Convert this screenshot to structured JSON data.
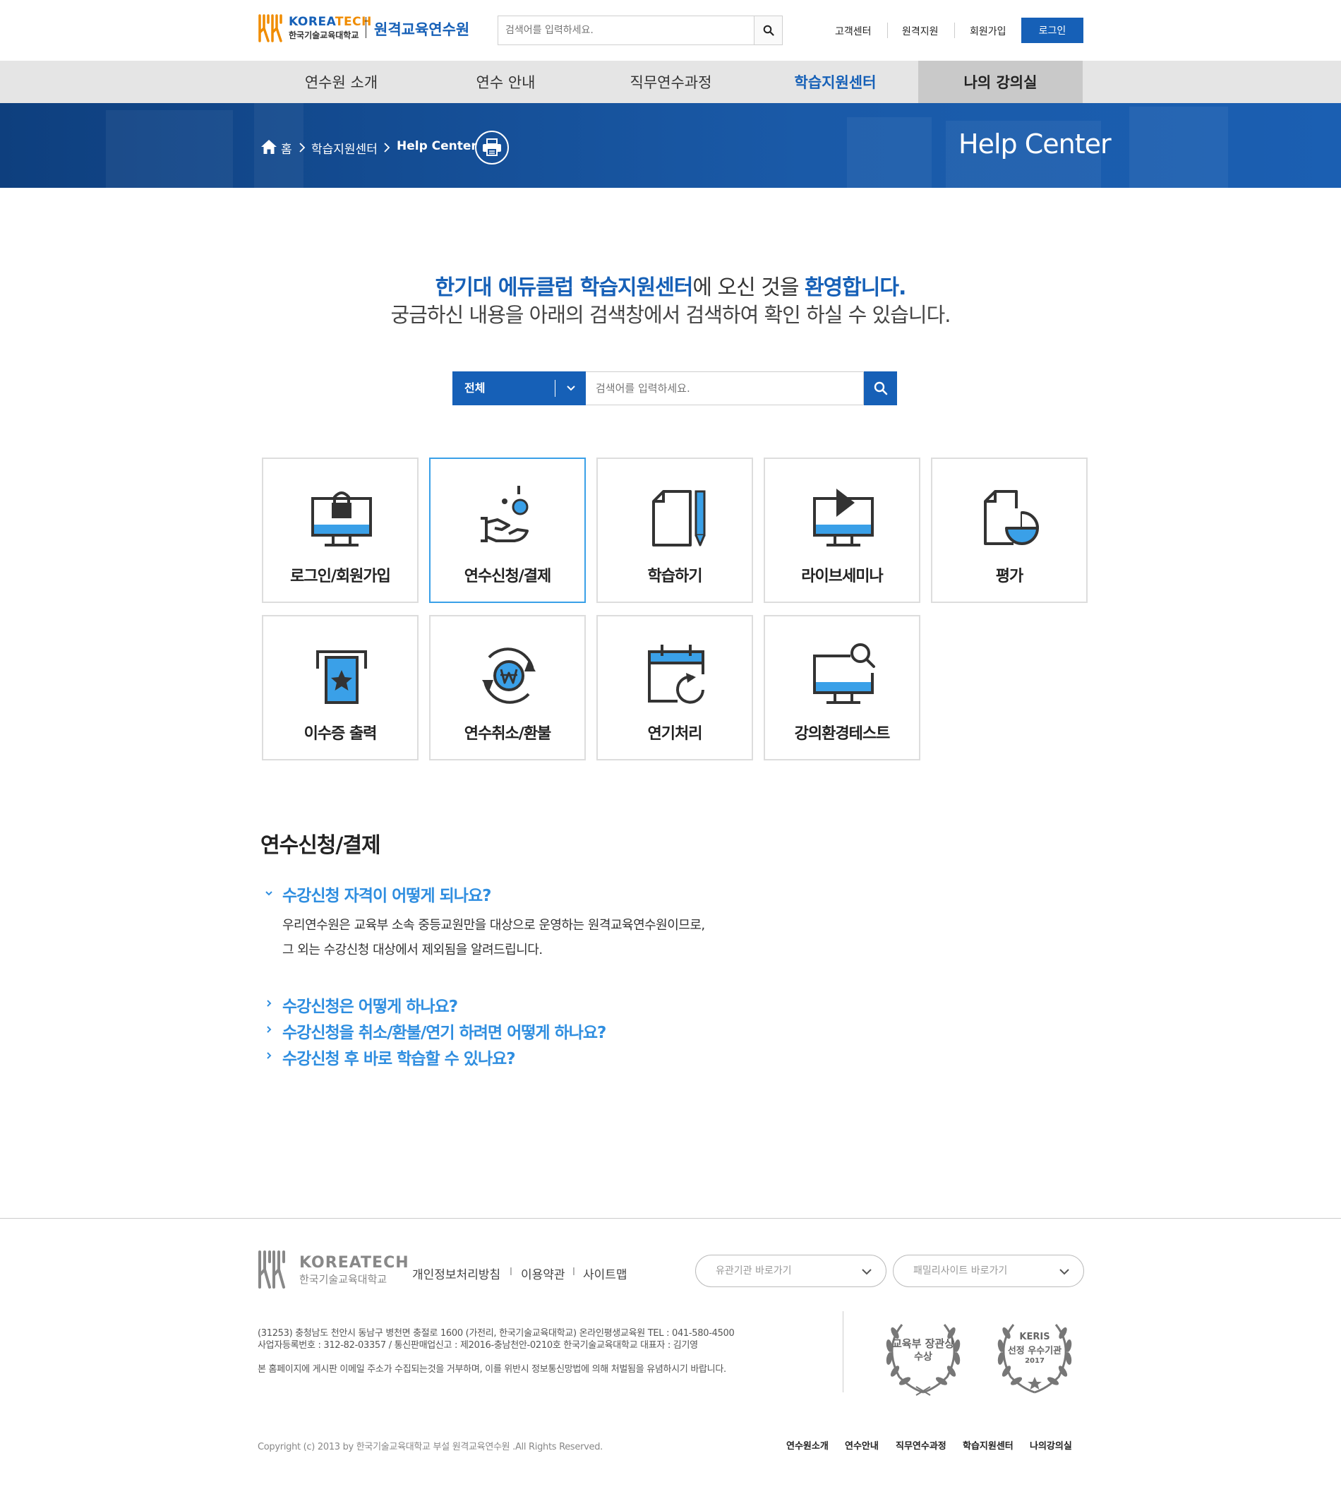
{
  "header": {
    "logo_en_a": "KOREA",
    "logo_en_b": "TECH",
    "logo_ko": "한국기술교육대학교",
    "site_title": "원격교육연수원",
    "search_placeholder": "검색어를 입력하세요.",
    "util_links": [
      "고객센터",
      "원격지원",
      "회원가입"
    ],
    "login_label": "로그인"
  },
  "gnb": {
    "items": [
      "연수원 소개",
      "연수 안내",
      "직무연수과정",
      "학습지원센터",
      "나의 강의실"
    ],
    "active_index": 3
  },
  "banner": {
    "breadcrumb": [
      "홈",
      "학습지원센터",
      "Help Center"
    ],
    "title": "Help Center"
  },
  "welcome": {
    "line1_hl1": "한기대 에듀클럽 학습지원센터",
    "line1_mid": "에 오신 것을 ",
    "line1_hl2": "환영합니다.",
    "line2": "궁금하신 내용을 아래의 검색창에서 검색하여 확인 하실 수 있습니다."
  },
  "main_search": {
    "category": "전체",
    "placeholder": "검색어를 입력하세요."
  },
  "categories": [
    {
      "label": "로그인/회원가입",
      "icon": "monitor-lock-icon"
    },
    {
      "label": "연수신청/결제",
      "icon": "hand-coin-icon"
    },
    {
      "label": "학습하기",
      "icon": "document-pencil-icon"
    },
    {
      "label": "라이브세미나",
      "icon": "monitor-play-icon"
    },
    {
      "label": "평가",
      "icon": "document-pie-icon"
    },
    {
      "label": "이수증 출력",
      "icon": "certificate-star-icon"
    },
    {
      "label": "연수취소/환불",
      "icon": "won-refresh-icon"
    },
    {
      "label": "연기처리",
      "icon": "calendar-refresh-icon"
    },
    {
      "label": "강의환경테스트",
      "icon": "monitor-search-icon"
    }
  ],
  "selected_category_index": 1,
  "faq": {
    "section_title": "연수신청/결제",
    "items": [
      {
        "q": "수강신청 자격이 어떻게 되나요?",
        "open": true,
        "a": [
          "우리연수원은 교육부 소속 중등교원만을 대상으로 운영하는 원격교육연수원이므로,",
          "그 외는 수강신청 대상에서 제외됨을 알려드립니다."
        ]
      },
      {
        "q": "수강신청은 어떻게 하나요?",
        "open": false
      },
      {
        "q": "수강신청을 취소/환불/연기 하려면 어떻게 하나요?",
        "open": false
      },
      {
        "q": "수강신청 후 바로 학습할 수 있나요?",
        "open": false
      }
    ]
  },
  "footer": {
    "logo_en": "KOREATECH",
    "logo_ko": "한국기술교육대학교",
    "links": [
      "개인정보처리방침",
      "이용약관",
      "사이트맵"
    ],
    "link_sep": "l",
    "select_related": "유관기관 바로가기",
    "select_family": "패밀리사이트 바로가기",
    "info": [
      "(31253) 충청남도 천안시 동남구 병천면 충절로 1600 (가전리, 한국기술교육대학교) 온라인평생교육원 TEL : 041-580-4500",
      "사업자등록번호 : 312-82-03357 / 통신판매업신고 : 제2016-충남천안-0210호 한국기술교육대학교 대표자 : 김기영",
      "본 홈페이지에 게시판 이메일 주소가 수집되는것을 거부하며, 이를 위반시 정보통신망법에 의해 처벌됨을 유념하시기 바랍니다."
    ],
    "award1": [
      "교육부 장관상",
      "수상"
    ],
    "award2": [
      "KERIS",
      "선정 우수기관",
      "2017"
    ],
    "copyright": "Copyright (c) 2013 by 한국기술교육대학교 부설 원격교육연수원 .All Rights Reserved.",
    "menu": [
      "연수원소개",
      "연수안내",
      "직무연수과정",
      "학습지원센터",
      "나의강의실"
    ]
  },
  "colors": {
    "primary": "#1660b7",
    "accent_orange": "#f08c00",
    "icon_blue": "#3aa0e8",
    "faq_blue": "#2f8ee0"
  }
}
